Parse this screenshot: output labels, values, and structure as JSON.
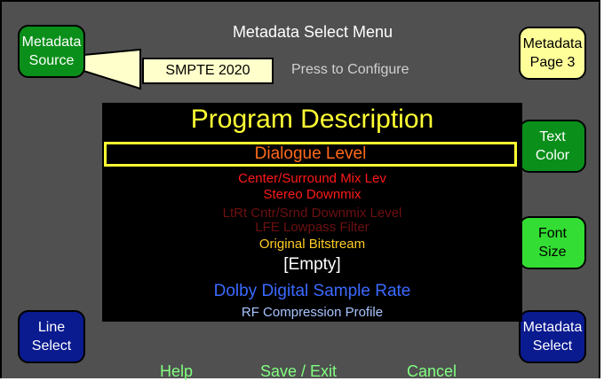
{
  "header": {
    "title": "Metadata Select Menu"
  },
  "metadata_source": {
    "button_line1": "Metadata",
    "button_line2": "Source",
    "value": "SMPTE 2020",
    "hint": "Press to Configure"
  },
  "side_buttons": {
    "metadata_page": {
      "line1": "Metadata",
      "line2": "Page 3"
    },
    "text_color": {
      "line1": "Text",
      "line2": "Color"
    },
    "font_size": {
      "line1": "Font",
      "line2": "Size"
    },
    "line_select": {
      "line1": "Line",
      "line2": "Select"
    },
    "metadata_select": {
      "line1": "Metadata",
      "line2": "Select"
    }
  },
  "panel": {
    "title": "Program Description",
    "items": [
      {
        "label": "Dialogue Level",
        "color": "#ff6a1a",
        "selected": true
      },
      {
        "label": "Center/Surround Mix Lev",
        "color": "#ff1a1a"
      },
      {
        "label": "Stereo Downmix",
        "color": "#ff1a1a"
      },
      {
        "label": "LtRt Cntr/Srnd Downmix Level",
        "color": "#6e1010"
      },
      {
        "label": "LFE Lowpass Filter",
        "color": "#6e1010"
      },
      {
        "label": "Original Bitstream",
        "color": "#ffcc22"
      },
      {
        "label": "[Empty]",
        "color": "#ffffff"
      },
      {
        "label": "Dolby Digital Sample Rate",
        "color": "#3a6aff"
      },
      {
        "label": "RF Compression Profile",
        "color": "#a8c4ff"
      }
    ]
  },
  "footer": {
    "help": "Help",
    "save_exit": "Save / Exit",
    "cancel": "Cancel"
  },
  "colors": {
    "background": "#505050",
    "selection_border": "#ffff33",
    "footer_text": "#80ff80"
  }
}
